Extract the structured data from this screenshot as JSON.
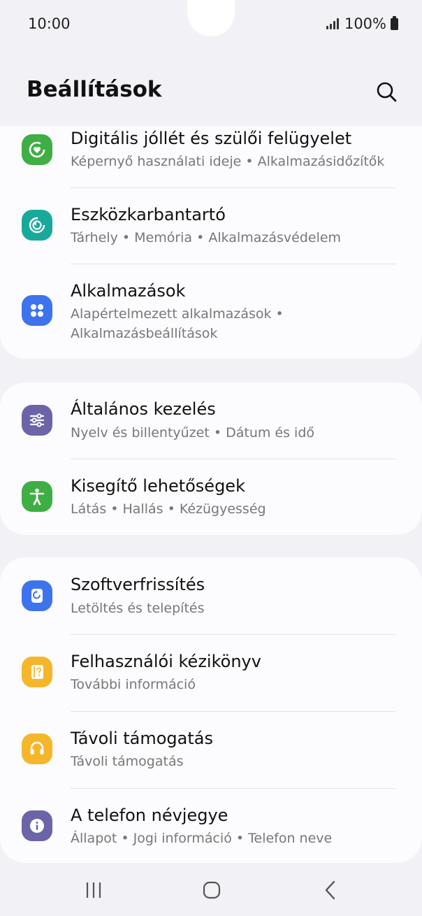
{
  "status": {
    "time": "10:00",
    "battery": "100%"
  },
  "header": {
    "title": "Beállítások"
  },
  "colors": {
    "green": "#3fae44",
    "teal": "#19a99b",
    "blue": "#3d74ee",
    "purple": "#6b64a9",
    "yellow": "#f6b62b"
  },
  "groups": [
    {
      "items": [
        {
          "title": "Digitális jóllét és szülői felügyelet",
          "subtitle": "Képernyő használati ideje  •  Alkalmazásidőzítők",
          "icon": "heart-dial-icon"
        },
        {
          "title": "Eszközkarbantartó",
          "subtitle": "Tárhely  •  Memória  •  Alkalmazásvédelem",
          "icon": "device-care-icon"
        },
        {
          "title": "Alkalmazások",
          "subtitle": "Alapértelmezett alkalmazások  •",
          "subtitle2": "Alkalmazásbeállítások",
          "icon": "apps-grid-icon"
        }
      ]
    },
    {
      "items": [
        {
          "title": "Általános kezelés",
          "subtitle": "Nyelv és billentyűzet  •  Dátum és idő",
          "icon": "sliders-icon"
        },
        {
          "title": "Kisegítő lehetőségek",
          "subtitle": "Látás  •  Hallás  •  Kézügyesség",
          "icon": "accessibility-icon"
        }
      ]
    },
    {
      "items": [
        {
          "title": "Szoftverfrissítés",
          "subtitle": "Letöltés és telepítés",
          "icon": "software-update-icon"
        },
        {
          "title": "Felhasználói kézikönyv",
          "subtitle": "További információ",
          "icon": "user-manual-icon"
        },
        {
          "title": "Távoli támogatás",
          "subtitle": "Távoli támogatás",
          "icon": "headset-icon"
        },
        {
          "title": "A telefon névjegye",
          "subtitle": "Állapot  •  Jogi információ  •  Telefon neve",
          "icon": "info-icon"
        }
      ]
    }
  ],
  "navbar": {
    "recent": "recent-apps-icon",
    "home": "home-icon",
    "back": "back-icon"
  }
}
